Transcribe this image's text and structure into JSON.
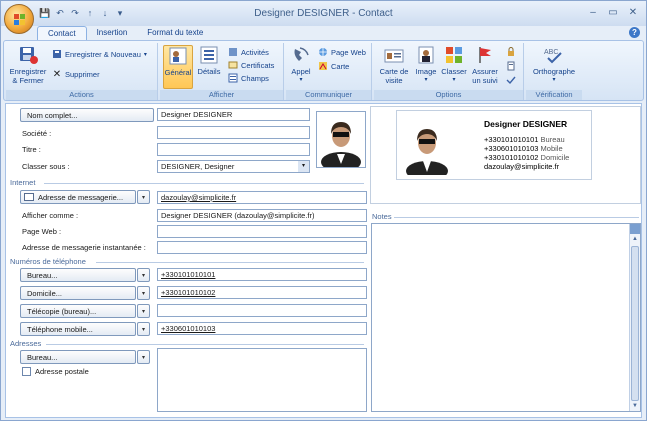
{
  "window": {
    "title": "Designer DESIGNER - Contact",
    "controls": {
      "minimize": "–",
      "maximize": "▭",
      "close": "✕"
    }
  },
  "qat": {
    "save": "💾",
    "undo": "↶",
    "redo": "↷",
    "up": "↑",
    "down": "↓",
    "more": "▾"
  },
  "tabs": [
    {
      "label": "Contact",
      "active": true
    },
    {
      "label": "Insertion",
      "active": false
    },
    {
      "label": "Format du texte",
      "active": false
    }
  ],
  "ribbon": {
    "actions": {
      "label": "Actions",
      "save_close": "Enregistrer & Fermer",
      "save_new": "Enregistrer & Nouveau",
      "delete": "Supprimer"
    },
    "afficher": {
      "label": "Afficher",
      "general": "Général",
      "details": "Détails",
      "activites": "Activités",
      "certificats": "Certificats",
      "champs": "Champs"
    },
    "communiquer": {
      "label": "Communiquer",
      "appel": "Appel",
      "page_web": "Page Web",
      "carte": "Carte"
    },
    "options": {
      "label": "Options",
      "carte_visite": "Carte de visite",
      "image": "Image",
      "classer": "Classer",
      "assurer_suivi": "Assurer un suivi"
    },
    "verification": {
      "label": "Vérification",
      "orthographe": "Orthographe",
      "abc": "ABC"
    }
  },
  "form": {
    "nom_complet_btn": "Nom complet...",
    "nom_complet": "Designer DESIGNER",
    "societe_label": "Société :",
    "societe": "",
    "titre_label": "Titre :",
    "titre": "",
    "classer_label": "Classer sous :",
    "classer_value": "DESIGNER, Designer",
    "internet_section": "Internet",
    "email_btn": "Adresse de messagerie...",
    "email": "dazoulay@simplicite.fr",
    "afficher_label": "Afficher comme :",
    "afficher_value": "Designer DESIGNER (dazoulay@simplicite.fr)",
    "page_web_label": "Page Web :",
    "page_web": "",
    "im_label": "Adresse de messagerie instantanée :",
    "im": "",
    "tel_section": "Numéros de téléphone",
    "bureau_btn": "Bureau...",
    "bureau": "+330101010101",
    "domicile_btn": "Domicile...",
    "domicile": "+330101010102",
    "telecopie_btn": "Télécopie (bureau)...",
    "telecopie": "",
    "mobile_btn": "Téléphone mobile...",
    "mobile": "+330601010103",
    "adresses_section": "Adresses",
    "adresse_btn": "Bureau...",
    "adresse_postale": "Adresse postale",
    "notes_label": "Notes"
  },
  "card": {
    "name": "Designer DESIGNER",
    "lines": [
      {
        "num": "+330101010101",
        "type": "Bureau"
      },
      {
        "num": "+330601010103",
        "type": "Mobile"
      },
      {
        "num": "+330101010102",
        "type": "Domicile"
      }
    ],
    "email": "dazoulay@simplicite.fr"
  },
  "icons": {
    "office": "office-logo-icon",
    "help": "?"
  }
}
